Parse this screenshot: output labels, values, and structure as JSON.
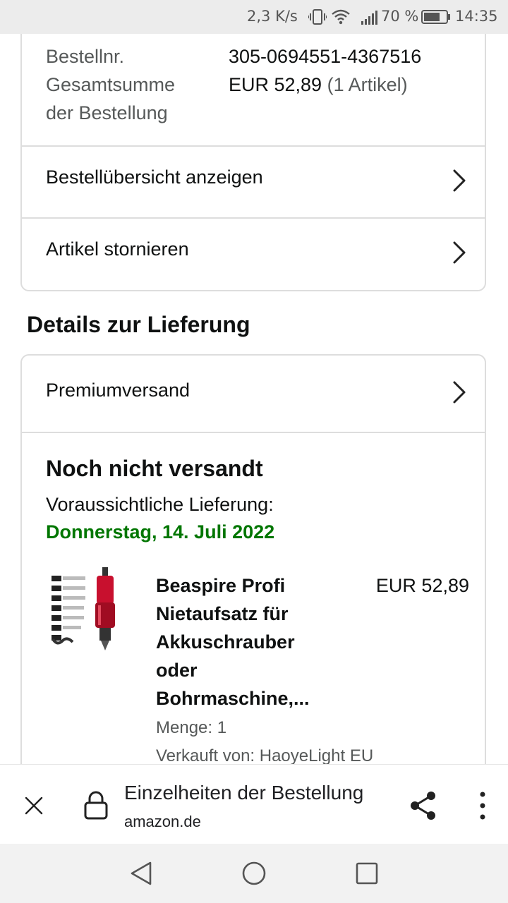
{
  "status_bar": {
    "speed": "2,3 K/s",
    "battery_percent": "70 %",
    "time": "14:35",
    "icons": [
      "vibrate-icon",
      "wifi-icon",
      "signal-icon",
      "battery-icon"
    ]
  },
  "order_summary": {
    "order_number_label": "Bestellnr.",
    "order_number_value": "305-0694551-4367516",
    "total_label_line1": "Gesamtsumme",
    "total_label_line2": "der Bestellung",
    "total_value": "EUR 52,89",
    "total_items": "(1 Artikel)",
    "links": [
      {
        "label": "Bestellübersicht anzeigen"
      },
      {
        "label": "Artikel stornieren"
      }
    ]
  },
  "delivery": {
    "heading": "Details zur Lieferung",
    "shipping_method": "Premiumversand",
    "status": "Noch nicht versandt",
    "expected_label": "Voraussichtliche Lieferung:",
    "expected_date": "Donnerstag, 14. Juli 2022",
    "item": {
      "title_lines": [
        "Beaspire Profi",
        "Nietaufsatz für",
        "Akkuschrauber",
        "oder",
        "Bohrmaschine,..."
      ],
      "price": "EUR 52,89",
      "quantity": "Menge: 1",
      "seller": "Verkauft von: HaoyeLight EU"
    }
  },
  "browser_bar": {
    "title": "Einzelheiten der Bestellung",
    "domain": "amazon.de"
  },
  "colors": {
    "green": "#007600",
    "border": "#dddddd",
    "muted_text": "#565959",
    "status_bar_bg": "#ececec",
    "product_red": "#c8102e"
  }
}
